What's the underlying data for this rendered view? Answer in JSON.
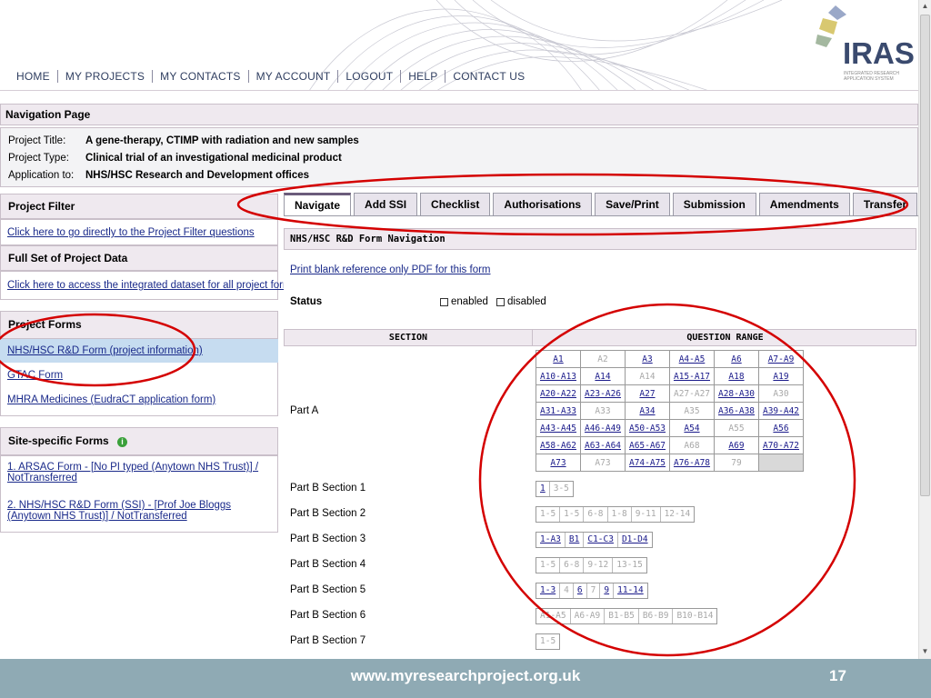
{
  "topnav": [
    "HOME",
    "MY PROJECTS",
    "MY CONTACTS",
    "MY ACCOUNT",
    "LOGOUT",
    "HELP",
    "CONTACT US"
  ],
  "logo": {
    "brand": "IRAS",
    "subtitle": "INTEGRATED RESEARCH APPLICATION SYSTEM"
  },
  "nav_page_title": "Navigation Page",
  "project": {
    "title_label": "Project Title:",
    "title": "A gene-therapy, CTIMP with radiation and new samples",
    "type_label": "Project Type:",
    "type": "Clinical trial of an investigational medicinal product",
    "app_label": "Application to:",
    "app": "NHS/HSC Research and Development offices"
  },
  "left": {
    "filter_head": "Project Filter",
    "filter_link": "Click here to go directly to the Project Filter questions",
    "fullset_head": "Full Set of Project Data",
    "fullset_link": "Click here to access the integrated dataset for all project forms",
    "forms_head": "Project Forms",
    "forms": [
      "NHS/HSC R&D Form (project information)",
      "GTAC Form",
      "MHRA Medicines (EudraCT application form)"
    ],
    "site_head": "Site-specific Forms",
    "site_forms": [
      "1. ARSAC Form - [No PI typed (Anytown NHS Trust)] / NotTransferred",
      "2. NHS/HSC R&D Form (SSI) - [Prof Joe Bloggs (Anytown NHS Trust)] / NotTransferred"
    ]
  },
  "tabs": [
    "Navigate",
    "Add SSI",
    "Checklist",
    "Authorisations",
    "Save/Print",
    "Submission",
    "Amendments",
    "Transfer"
  ],
  "main": {
    "heading": "NHS/HSC R&D Form Navigation",
    "print_link": "Print blank reference only PDF for this form",
    "status_label": "Status",
    "enabled": "enabled",
    "disabled": "disabled",
    "section_col": "SECTION",
    "range_col": "QUESTION RANGE"
  },
  "partA": {
    "label": "Part A",
    "rows": [
      [
        [
          "A1",
          1
        ],
        [
          "A2",
          0
        ],
        [
          "A3",
          1
        ],
        [
          "A4-A5",
          1
        ],
        [
          "A6",
          1
        ],
        [
          "A7-A9",
          1
        ]
      ],
      [
        [
          "A10-A13",
          1
        ],
        [
          "A14",
          1
        ],
        [
          "A14",
          0
        ],
        [
          "A15-A17",
          1
        ],
        [
          "A18",
          1
        ],
        [
          "A19",
          1
        ]
      ],
      [
        [
          "A20-A22",
          1
        ],
        [
          "A23-A26",
          1
        ],
        [
          "A27",
          1
        ],
        [
          "A27-A27",
          0
        ],
        [
          "A28-A30",
          1
        ],
        [
          "A30",
          0
        ]
      ],
      [
        [
          "A31-A33",
          1
        ],
        [
          "A33",
          0
        ],
        [
          "A34",
          1
        ],
        [
          "A35",
          0
        ],
        [
          "A36-A38",
          1
        ],
        [
          "A39-A42",
          1
        ]
      ],
      [
        [
          "A43-A45",
          1
        ],
        [
          "A46-A49",
          1
        ],
        [
          "A50-A53",
          1
        ],
        [
          "A54",
          1
        ],
        [
          "A55",
          0
        ],
        [
          "A56",
          1
        ]
      ],
      [
        [
          "A58-A62",
          1
        ],
        [
          "A63-A64",
          1
        ],
        [
          "A65-A67",
          1
        ],
        [
          "A68",
          0
        ],
        [
          "A69",
          1
        ],
        [
          "A70-A72",
          1
        ]
      ],
      [
        [
          "A73",
          1
        ],
        [
          "A73",
          0
        ],
        [
          "A74-A75",
          1
        ],
        [
          "A76-A78",
          1
        ],
        [
          "79",
          0
        ],
        [
          "",
          2
        ]
      ]
    ]
  },
  "sections": [
    {
      "label": "Part B Section 1",
      "chips": [
        [
          "1",
          1
        ],
        [
          "3-5",
          0
        ]
      ]
    },
    {
      "label": "Part B Section 2",
      "chips": [
        [
          "1-5",
          0
        ],
        [
          "1-5",
          0
        ],
        [
          "6-8",
          0
        ],
        [
          "1-8",
          0
        ],
        [
          "9-11",
          0
        ],
        [
          "12-14",
          0
        ]
      ]
    },
    {
      "label": "Part B Section 3",
      "chips": [
        [
          "1-A3",
          1
        ],
        [
          "B1",
          1
        ],
        [
          "C1-C3",
          1
        ],
        [
          "D1-D4",
          1
        ]
      ]
    },
    {
      "label": "Part B Section 4",
      "chips": [
        [
          "1-5",
          0
        ],
        [
          "6-8",
          0
        ],
        [
          "9-12",
          0
        ],
        [
          "13-15",
          0
        ]
      ]
    },
    {
      "label": "Part B Section 5",
      "chips": [
        [
          "1-3",
          1
        ],
        [
          "4",
          0
        ],
        [
          "6",
          1
        ],
        [
          "7",
          0
        ],
        [
          "9",
          1
        ],
        [
          "11-14",
          1
        ]
      ]
    },
    {
      "label": "Part B Section 6",
      "chips": [
        [
          "A1-A5",
          0
        ],
        [
          "A6-A9",
          0
        ],
        [
          "B1-B5",
          0
        ],
        [
          "B6-B9",
          0
        ],
        [
          "B10-B14",
          0
        ]
      ]
    },
    {
      "label": "Part B Section 7",
      "chips": [
        [
          "1-5",
          0
        ]
      ]
    }
  ],
  "footer": {
    "url": "www.myresearchproject.org.uk",
    "page": "17"
  },
  "colors": {
    "annotation": "#d40000",
    "footer": "#8faab4",
    "link": "#1a2a8a"
  }
}
